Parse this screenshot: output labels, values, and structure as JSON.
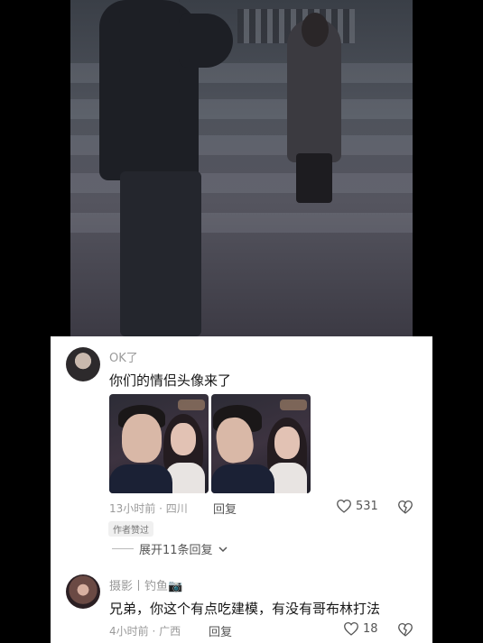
{
  "comments": [
    {
      "username": "OK了",
      "text": "你们的情侣头像来了",
      "time_location": "13小时前 · 四川",
      "reply_label": "回复",
      "likes": "531",
      "badge": "作者赞过",
      "expand_label": "展开11条回复"
    },
    {
      "username": "摄影丨钓鱼📷",
      "text": "兄弟，你这个有点吃建模，有没有哥布林打法",
      "time_location": "4小时前 · 广西",
      "reply_label": "回复",
      "likes": "18"
    }
  ],
  "icons": {
    "like": "heart-outline-icon",
    "dislike": "broken-heart-icon",
    "expand": "chevron-down-icon"
  },
  "colors": {
    "panel_bg": "#ffffff",
    "meta_text": "#9a9a9a",
    "body_text": "#161616",
    "page_bg": "#000000"
  }
}
